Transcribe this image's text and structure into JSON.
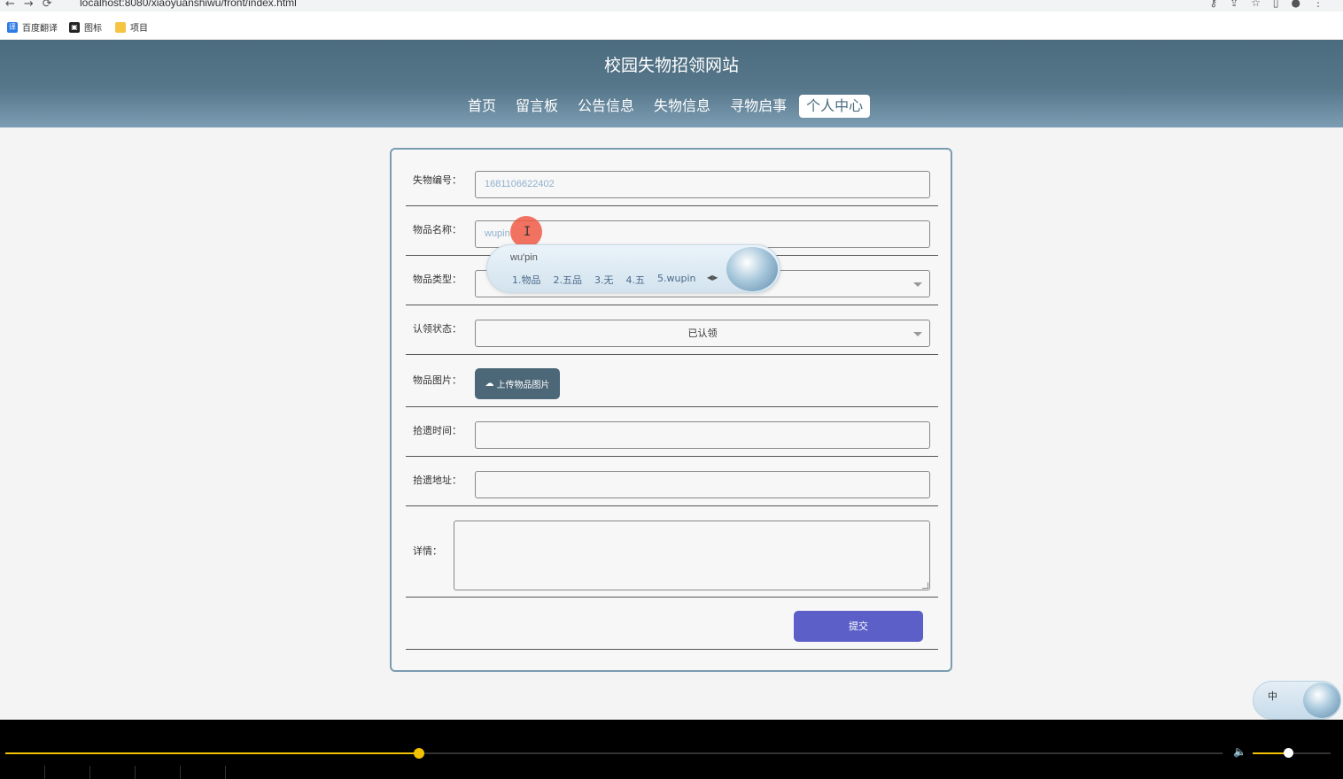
{
  "browser": {
    "url": "localhost:8080/xiaoyuanshiwu/front/index.html",
    "bookmarks": [
      {
        "label": "百度翻译",
        "icon": "translate-icon"
      },
      {
        "label": "图标",
        "icon": "image-icon"
      },
      {
        "label": "项目",
        "icon": "folder-icon"
      }
    ]
  },
  "site": {
    "title": "校园失物招领网站",
    "nav": [
      "首页",
      "留言板",
      "公告信息",
      "失物信息",
      "寻物启事",
      "个人中心"
    ],
    "active_nav": "个人中心"
  },
  "form": {
    "item_no": {
      "label": "失物编号：",
      "value": "1681106622402"
    },
    "item_name": {
      "label": "物品名称：",
      "value": "wupin"
    },
    "item_type": {
      "label": "物品类型：",
      "value": ""
    },
    "claim_status": {
      "label": "认领状态：",
      "value": "已认领"
    },
    "item_image": {
      "label": "物品图片：",
      "button": "上传物品图片"
    },
    "found_time": {
      "label": "拾遗时间：",
      "value": ""
    },
    "found_address": {
      "label": "拾遗地址：",
      "value": ""
    },
    "details": {
      "label": "详情：",
      "value": ""
    },
    "submit": "提交"
  },
  "ime": {
    "pinyin": "wu'pin",
    "candidates": [
      "1.物品",
      "2.五品",
      "3.无",
      "4.五",
      "5.wupin"
    ],
    "mode": "中"
  },
  "player": {
    "progress": 0.34,
    "volume": 0.45
  },
  "colors": {
    "header": "#56768a",
    "submit": "#5b5fc7",
    "upload": "#4c6778",
    "progress": "#f2c200"
  }
}
